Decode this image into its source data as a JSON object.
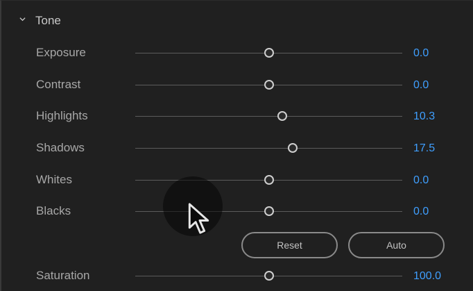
{
  "section": {
    "title": "Tone",
    "expanded": true,
    "icon": "chevron-down-icon"
  },
  "sliders": [
    {
      "key": "exposure",
      "label": "Exposure",
      "value": "0.0",
      "position": 0.5
    },
    {
      "key": "contrast",
      "label": "Contrast",
      "value": "0.0",
      "position": 0.5
    },
    {
      "key": "highlights",
      "label": "Highlights",
      "value": "10.3",
      "position": 0.55
    },
    {
      "key": "shadows",
      "label": "Shadows",
      "value": "17.5",
      "position": 0.59
    },
    {
      "key": "whites",
      "label": "Whites",
      "value": "0.0",
      "position": 0.5
    },
    {
      "key": "blacks",
      "label": "Blacks",
      "value": "0.0",
      "position": 0.5
    },
    {
      "key": "saturation",
      "label": "Saturation",
      "value": "100.0",
      "position": 0.5
    }
  ],
  "buttons": {
    "reset_label": "Reset",
    "auto_label": "Auto"
  },
  "colors": {
    "background": "#202020",
    "value_text": "#3f9fff",
    "label_text": "#a8a8a8",
    "track": "#5c5c5c"
  }
}
